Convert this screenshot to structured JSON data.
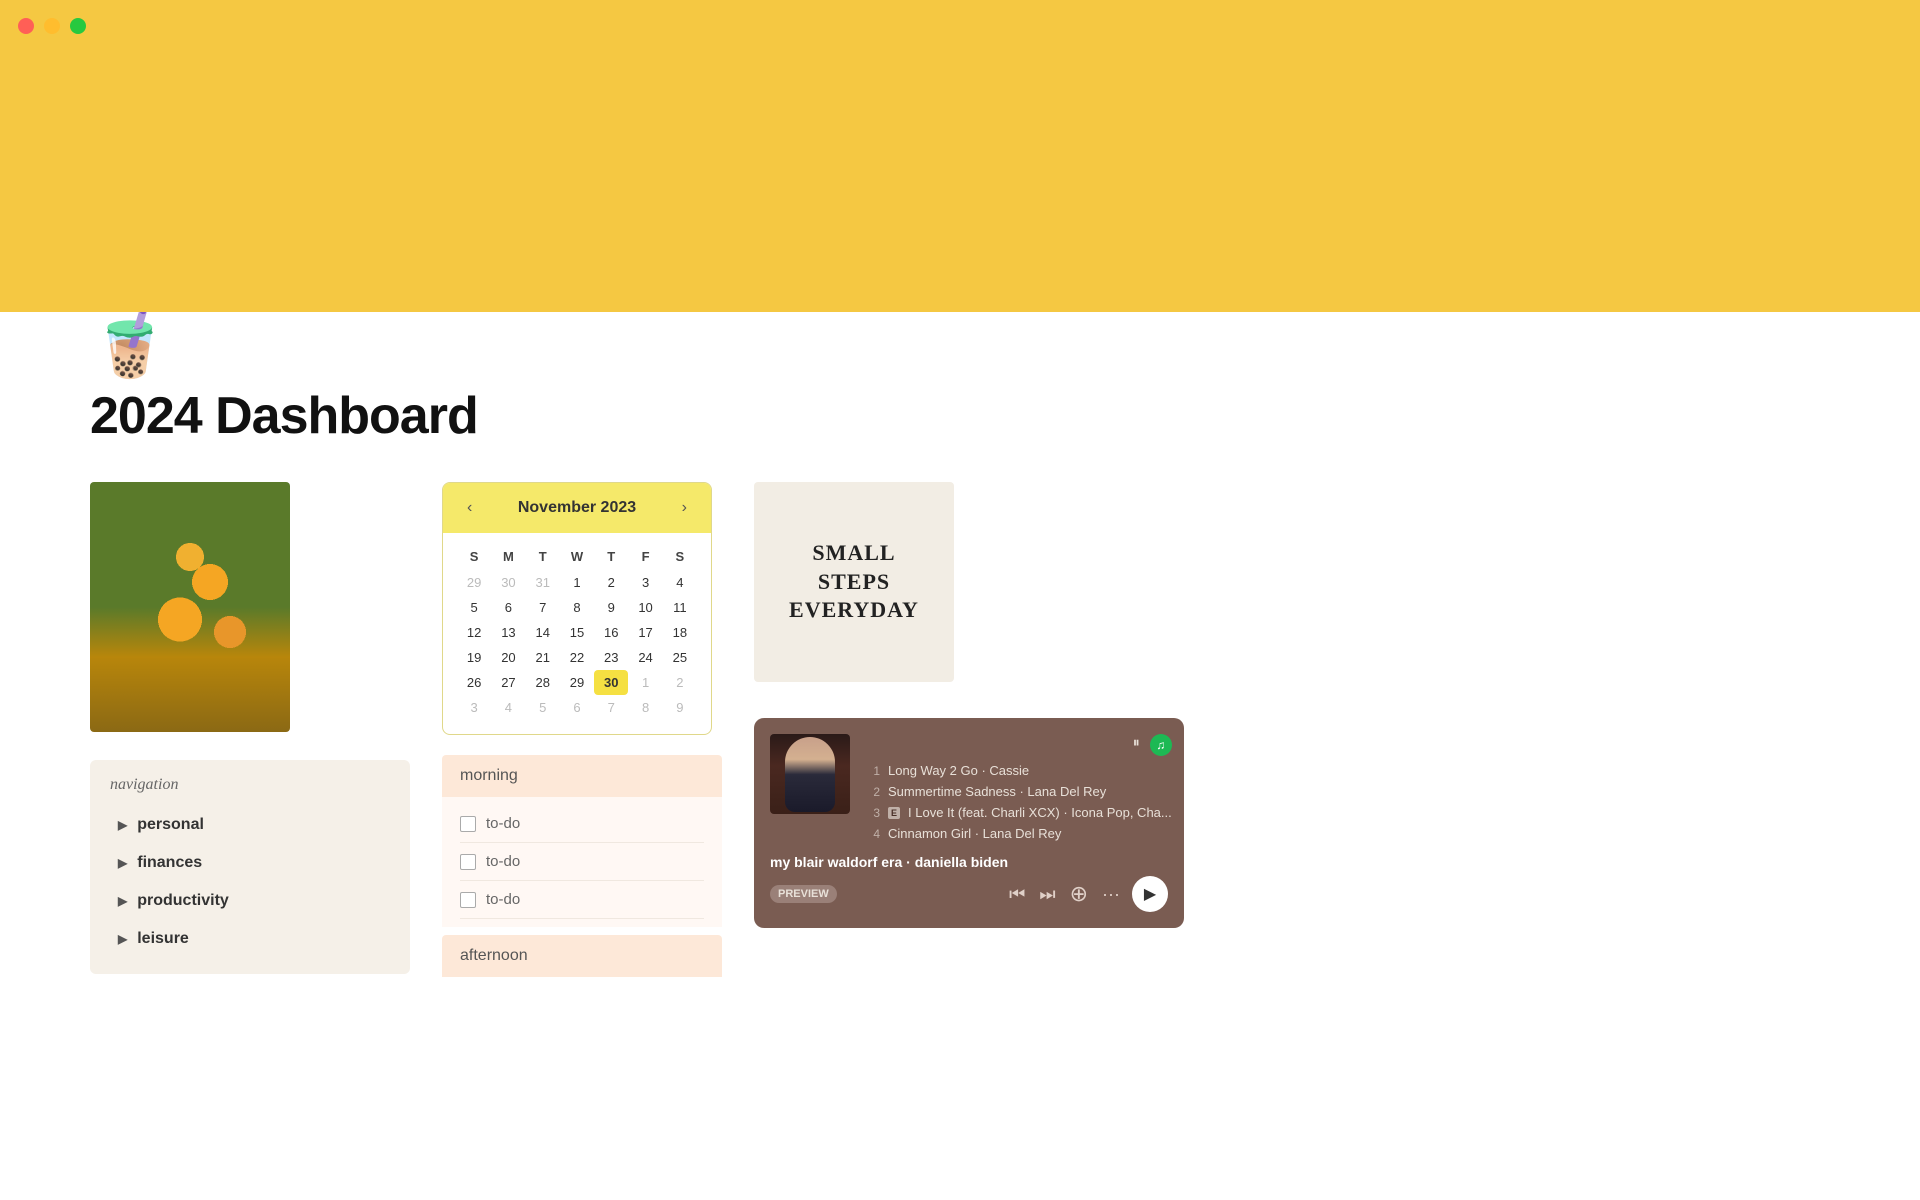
{
  "titlebar": {
    "title": "2024 Dashboard"
  },
  "header": {
    "icon": "🧋",
    "title": "2024  Dashboard"
  },
  "calendar": {
    "month_title": "November 2023",
    "prev_label": "‹",
    "next_label": "›",
    "day_headers": [
      "S",
      "M",
      "T",
      "W",
      "T",
      "F",
      "S"
    ],
    "weeks": [
      [
        {
          "label": "29",
          "muted": true
        },
        {
          "label": "30",
          "muted": true
        },
        {
          "label": "31",
          "muted": true
        },
        {
          "label": "1"
        },
        {
          "label": "2"
        },
        {
          "label": "3"
        },
        {
          "label": "4"
        }
      ],
      [
        {
          "label": "5"
        },
        {
          "label": "6"
        },
        {
          "label": "7"
        },
        {
          "label": "8"
        },
        {
          "label": "9"
        },
        {
          "label": "10"
        },
        {
          "label": "11"
        }
      ],
      [
        {
          "label": "12"
        },
        {
          "label": "13"
        },
        {
          "label": "14"
        },
        {
          "label": "15"
        },
        {
          "label": "16"
        },
        {
          "label": "17"
        },
        {
          "label": "18"
        }
      ],
      [
        {
          "label": "19"
        },
        {
          "label": "20"
        },
        {
          "label": "21"
        },
        {
          "label": "22"
        },
        {
          "label": "23"
        },
        {
          "label": "24"
        },
        {
          "label": "25"
        }
      ],
      [
        {
          "label": "26"
        },
        {
          "label": "27"
        },
        {
          "label": "28"
        },
        {
          "label": "29"
        },
        {
          "label": "30",
          "today": true
        },
        {
          "label": "1",
          "muted": true
        },
        {
          "label": "2",
          "muted": true
        }
      ],
      [
        {
          "label": "3",
          "muted": true
        },
        {
          "label": "4",
          "muted": true
        },
        {
          "label": "5",
          "muted": true
        },
        {
          "label": "6",
          "muted": true
        },
        {
          "label": "7",
          "muted": true
        },
        {
          "label": "8",
          "muted": true
        },
        {
          "label": "9",
          "muted": true
        }
      ]
    ]
  },
  "quote": {
    "text": "SMALL STEPS EVERYDAY"
  },
  "spotify": {
    "playlist_name": "my blair waldorf era · daniella biden",
    "preview_label": "PREVIEW",
    "tracks": [
      {
        "num": "1",
        "name": "Long Way 2 Go",
        "artist": "Cassie",
        "explicit": false
      },
      {
        "num": "2",
        "name": "Summertime Sadness",
        "artist": "Lana Del Rey",
        "explicit": false
      },
      {
        "num": "3",
        "name": "I Love It (feat. Charli XCX)",
        "artist": "Icona Pop, Cha...",
        "explicit": true
      },
      {
        "num": "4",
        "name": "Cinnamon Girl",
        "artist": "Lana Del Rey",
        "explicit": false
      }
    ]
  },
  "navigation": {
    "label": "navigation",
    "items": [
      {
        "label": "personal"
      },
      {
        "label": "finances"
      },
      {
        "label": "productivity"
      },
      {
        "label": "leisure"
      }
    ]
  },
  "todo": {
    "morning_label": "morning",
    "afternoon_label": "afternoon",
    "morning_items": [
      {
        "label": "to-do"
      },
      {
        "label": "to-do"
      },
      {
        "label": "to-do"
      }
    ]
  }
}
